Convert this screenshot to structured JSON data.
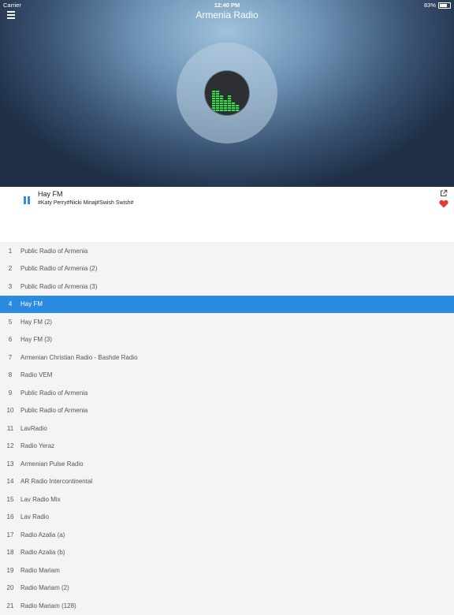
{
  "status_bar": {
    "carrier": "Carrier",
    "time": "12:40 PM",
    "battery": "83%"
  },
  "header": {
    "title": "Armenia Radio"
  },
  "player": {
    "station": "Hay FM",
    "track": "#Katy Perry#Nicki Minaj#Swish Swish#",
    "accent_color": "#2e8fd9",
    "heart_color": "#e53935"
  },
  "stations": [
    {
      "num": "1",
      "name": "Public Radio of Armenia"
    },
    {
      "num": "2",
      "name": "Public Radio of Armenia (2)"
    },
    {
      "num": "3",
      "name": "Public Radio of Armenia (3)"
    },
    {
      "num": "4",
      "name": "Hay FM"
    },
    {
      "num": "5",
      "name": "Hay FM (2)"
    },
    {
      "num": "6",
      "name": "Hay FM (3)"
    },
    {
      "num": "7",
      "name": "Armenian Christian Radio - Bashde Radio"
    },
    {
      "num": "8",
      "name": "Radio VEM"
    },
    {
      "num": "9",
      "name": "Public Radio of Armenia"
    },
    {
      "num": "10",
      "name": "Public Radio of Armenia"
    },
    {
      "num": "11",
      "name": "LavRadio"
    },
    {
      "num": "12",
      "name": "Radio Yeraz"
    },
    {
      "num": "13",
      "name": "Armenian Pulse Radio"
    },
    {
      "num": "14",
      "name": "AR Radio Intercontinental"
    },
    {
      "num": "15",
      "name": "Lav Radio Mix"
    },
    {
      "num": "16",
      "name": "Lav Radio"
    },
    {
      "num": "17",
      "name": "Radio Azalia (a)"
    },
    {
      "num": "18",
      "name": "Radio Azalia (b)"
    },
    {
      "num": "19",
      "name": "Radio Mariam"
    },
    {
      "num": "20",
      "name": "Radio Mariam (2)"
    },
    {
      "num": "21",
      "name": "Radio Mariam (128)"
    }
  ],
  "active_station_index": 3,
  "active_color": "#2a8be0",
  "equalizer_color": "#2ee84a"
}
